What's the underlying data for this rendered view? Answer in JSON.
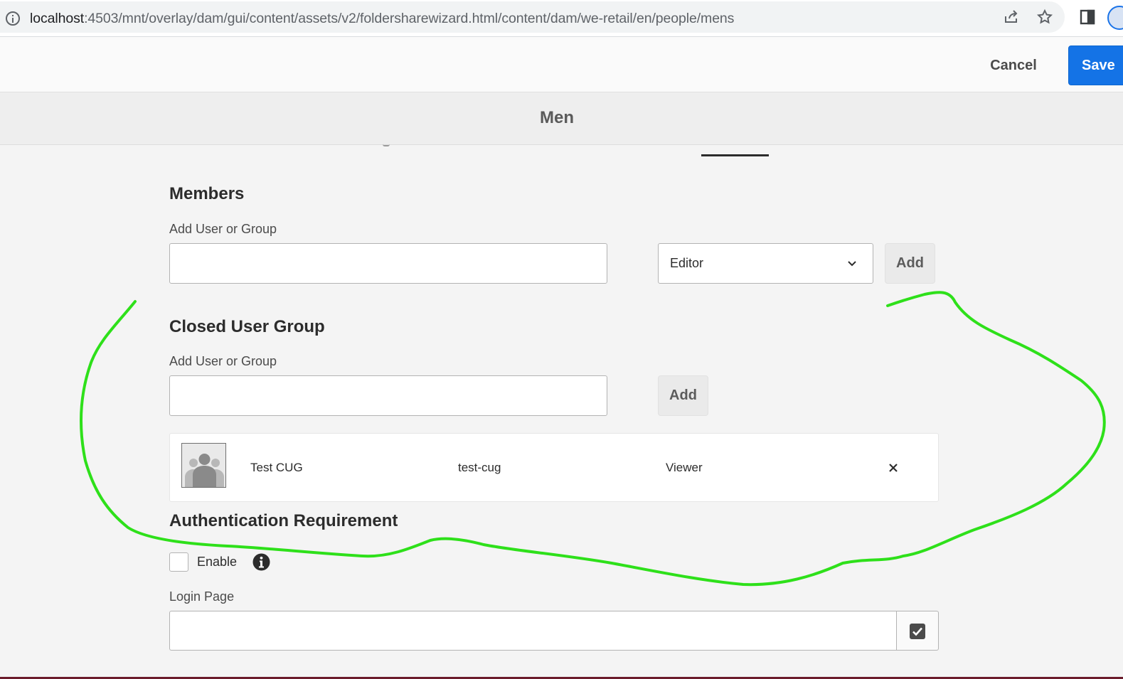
{
  "browser": {
    "url_host": "localhost",
    "url_rest": ":4503/mnt/overlay/dam/gui/content/assets/v2/foldersharewizard.html/content/dam/we-retail/en/people/mens",
    "icons": [
      "info-icon",
      "share-icon",
      "star-icon",
      "side-panel-icon"
    ]
  },
  "header": {
    "cancel_label": "Cancel",
    "save_label": "Save"
  },
  "title": "Men",
  "members": {
    "heading": "Members",
    "input_label": "Add User or Group",
    "input_value": "",
    "role_selected": "Editor",
    "add_label": "Add"
  },
  "cug": {
    "heading": "Closed User Group",
    "input_label": "Add User or Group",
    "input_value": "",
    "add_label": "Add",
    "entries": [
      {
        "name": "Test CUG",
        "id": "test-cug",
        "role": "Viewer"
      }
    ]
  },
  "auth": {
    "heading": "Authentication Requirement",
    "enable_label": "Enable",
    "enabled": false,
    "login_label": "Login Page",
    "login_value": ""
  },
  "colors": {
    "accent": "#1473e6",
    "annotation": "#2ee01a",
    "background": "#f4f4f4"
  }
}
